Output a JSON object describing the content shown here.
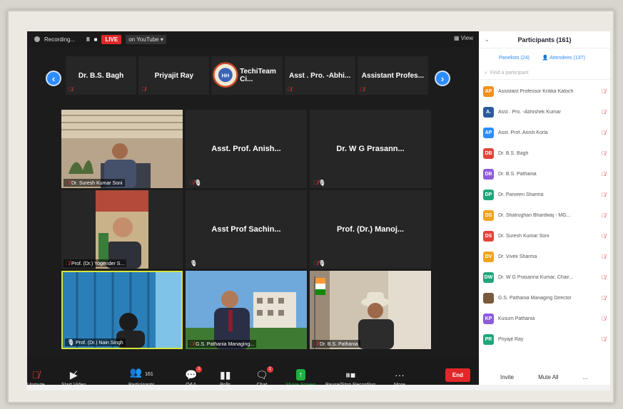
{
  "topbar": {
    "recording": "Recording...",
    "pause": "II",
    "stop": "■",
    "live": "LIVE",
    "youtube": "on YouTube ▾",
    "view": "View"
  },
  "strip": [
    {
      "name": "Dr. B.S. Bagh"
    },
    {
      "name": "Priyajit Ray"
    },
    {
      "name": "TechiTeam Ci...",
      "logo": true
    },
    {
      "name": "Asst . Pro. -Abhi..."
    },
    {
      "name": "Assistant Profes..."
    }
  ],
  "grid": [
    {
      "tag": "Dr. Suresh Kumar Soni",
      "video": "office-man"
    },
    {
      "name": "Asst. Prof. Anish...",
      "tag": ""
    },
    {
      "name": "Dr. W G Prasann...",
      "tag": ""
    },
    {
      "tag": "Prof. (Dr.) Yogender S...",
      "video": "bald-man"
    },
    {
      "name": "Asst Prof Sachin...",
      "tag": ""
    },
    {
      "name": "Prof. (Dr.) Manoj...",
      "tag": ""
    },
    {
      "tag": "Prof. (Dr.) Nain Singh",
      "video": "blue-room"
    },
    {
      "tag": "G.S. Pathania Managing...",
      "video": "outdoor-man"
    },
    {
      "tag": "Dr. B.S. Pathania",
      "video": "hat-man"
    }
  ],
  "toolbar": [
    {
      "label": "Unmute",
      "icon": "mic-muted-icon"
    },
    {
      "label": "Start Video",
      "icon": "video-off-icon"
    },
    {
      "label": "Participants",
      "icon": "participants-icon",
      "count": "161"
    },
    {
      "label": "Q&A",
      "icon": "qa-icon",
      "badge": "1"
    },
    {
      "label": "Polls",
      "icon": "polls-icon"
    },
    {
      "label": "Chat",
      "icon": "chat-icon",
      "badge": "1"
    },
    {
      "label": "Share Screen",
      "icon": "share-screen-icon"
    },
    {
      "label": "Pause/Stop Recording",
      "icon": "recording-icon"
    },
    {
      "label": "More",
      "icon": "more-icon"
    }
  ],
  "end_label": "End",
  "panel": {
    "title": "Participants (161)",
    "tab_panelists": "Panelists (24)",
    "tab_attendees": "Attendees (137)",
    "search_placeholder": "Find a participant",
    "invite": "Invite",
    "mute_all": "Mute All",
    "more": "...",
    "participants": [
      {
        "initials": "AP",
        "name": "Assistant Professor Kritika Katoch",
        "color": "#f0901e"
      },
      {
        "initials": "A.",
        "name": "Asst . Pro. -Abhishek Kumar",
        "color": "#2a5b9c"
      },
      {
        "initials": "AP",
        "name": "Asst. Prof. Anish Korla",
        "color": "#2d8cff"
      },
      {
        "initials": "DB",
        "name": "Dr. B.S. Bagh",
        "color": "#e0453b"
      },
      {
        "initials": "DB",
        "name": "Dr. B.S. Pathania",
        "color": "#8e5cd9"
      },
      {
        "initials": "DP",
        "name": "Dr. Parveen Sharma",
        "color": "#21a47c"
      },
      {
        "initials": "DS",
        "name": "Dr. Shatrughan Bhardwaj - MG...",
        "color": "#f0a31e"
      },
      {
        "initials": "DS",
        "name": "Dr. Suresh Kumar Soni",
        "color": "#e0453b"
      },
      {
        "initials": "DV",
        "name": "Dr. Vivek Sharma",
        "color": "#f0a31e"
      },
      {
        "initials": "DW",
        "name": "Dr. W G Prasanna Kumar, Chair...",
        "color": "#21a47c"
      },
      {
        "initials": "",
        "name": "G.S. Pathania Managing Director",
        "color": "#7a5a3c"
      },
      {
        "initials": "KP",
        "name": "Kusum Pathania",
        "color": "#8e5cd9"
      },
      {
        "initials": "PR",
        "name": "Priyajit Ray",
        "color": "#21a47c"
      }
    ]
  }
}
